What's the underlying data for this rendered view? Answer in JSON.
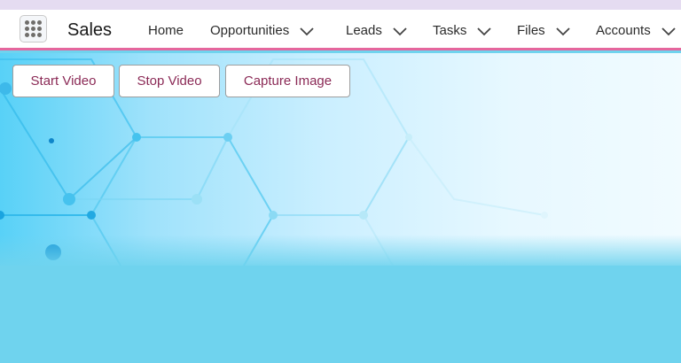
{
  "app": {
    "name": "Sales"
  },
  "nav": {
    "items": [
      {
        "label": "Home",
        "has_menu": false
      },
      {
        "label": "Opportunities",
        "has_menu": true
      },
      {
        "label": "Leads",
        "has_menu": true
      },
      {
        "label": "Tasks",
        "has_menu": true
      },
      {
        "label": "Files",
        "has_menu": true
      },
      {
        "label": "Accounts",
        "has_menu": true
      }
    ]
  },
  "actions": {
    "start_video": "Start Video",
    "stop_video": "Stop Video",
    "capture_image": "Capture Image"
  },
  "colors": {
    "accent_border": "#e5669d",
    "button_text": "#8b2a56",
    "background": "#6fd3ee"
  },
  "icons": {
    "launcher": "app-launcher-grid-icon",
    "menu": "chevron-down-icon"
  }
}
